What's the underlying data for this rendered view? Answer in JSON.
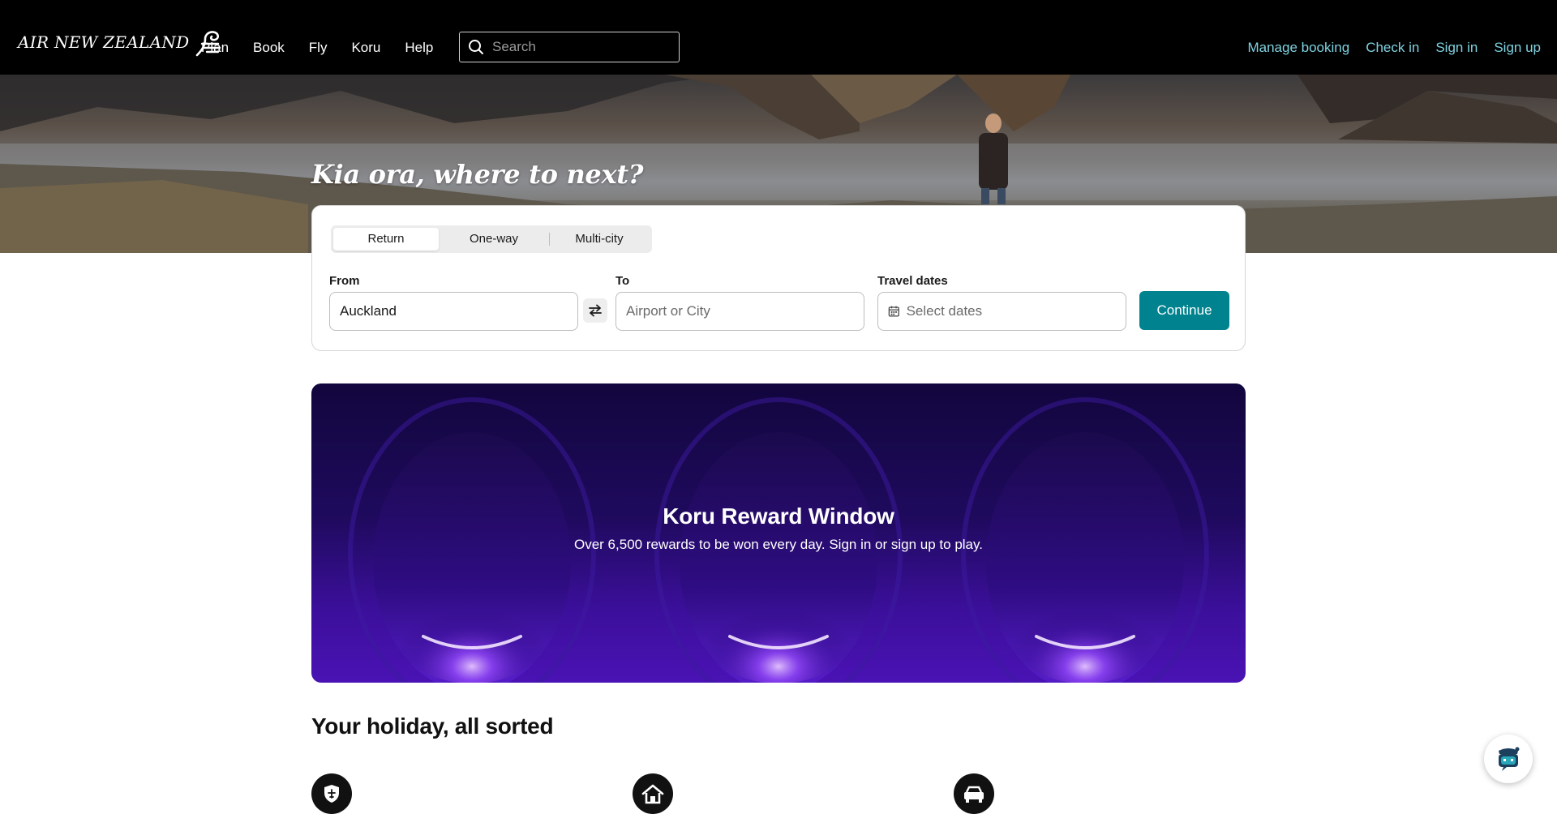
{
  "brand": {
    "name": "AIR NEW ZEALAND",
    "accent": "#00838f",
    "link_color": "#7fd2e0"
  },
  "nav": {
    "items": [
      {
        "label": "Plan"
      },
      {
        "label": "Book"
      },
      {
        "label": "Fly"
      },
      {
        "label": "Koru"
      },
      {
        "label": "Help"
      }
    ],
    "search_placeholder": "Search",
    "right_links": [
      {
        "label": "Manage booking"
      },
      {
        "label": "Check in"
      },
      {
        "label": "Sign in"
      },
      {
        "label": "Sign up"
      }
    ]
  },
  "hero": {
    "title": "Kia ora, where to next?"
  },
  "booking": {
    "trip_types": [
      {
        "label": "Return",
        "selected": true
      },
      {
        "label": "One-way",
        "selected": false
      },
      {
        "label": "Multi-city",
        "selected": false
      }
    ],
    "from": {
      "label": "From",
      "value": "Auckland"
    },
    "to": {
      "label": "To",
      "placeholder": "Airport or City"
    },
    "dates": {
      "label": "Travel dates",
      "placeholder": "Select dates"
    },
    "continue_label": "Continue"
  },
  "koru_banner": {
    "title": "Koru Reward Window",
    "subtitle": "Over 6,500 rewards to be won every day. Sign in or sign up to play."
  },
  "holiday": {
    "title": "Your holiday, all sorted",
    "icons": [
      "insurance-shield-plane-icon",
      "home-icon",
      "car-icon"
    ]
  },
  "chat": {
    "icon": "chatbot-icon"
  }
}
